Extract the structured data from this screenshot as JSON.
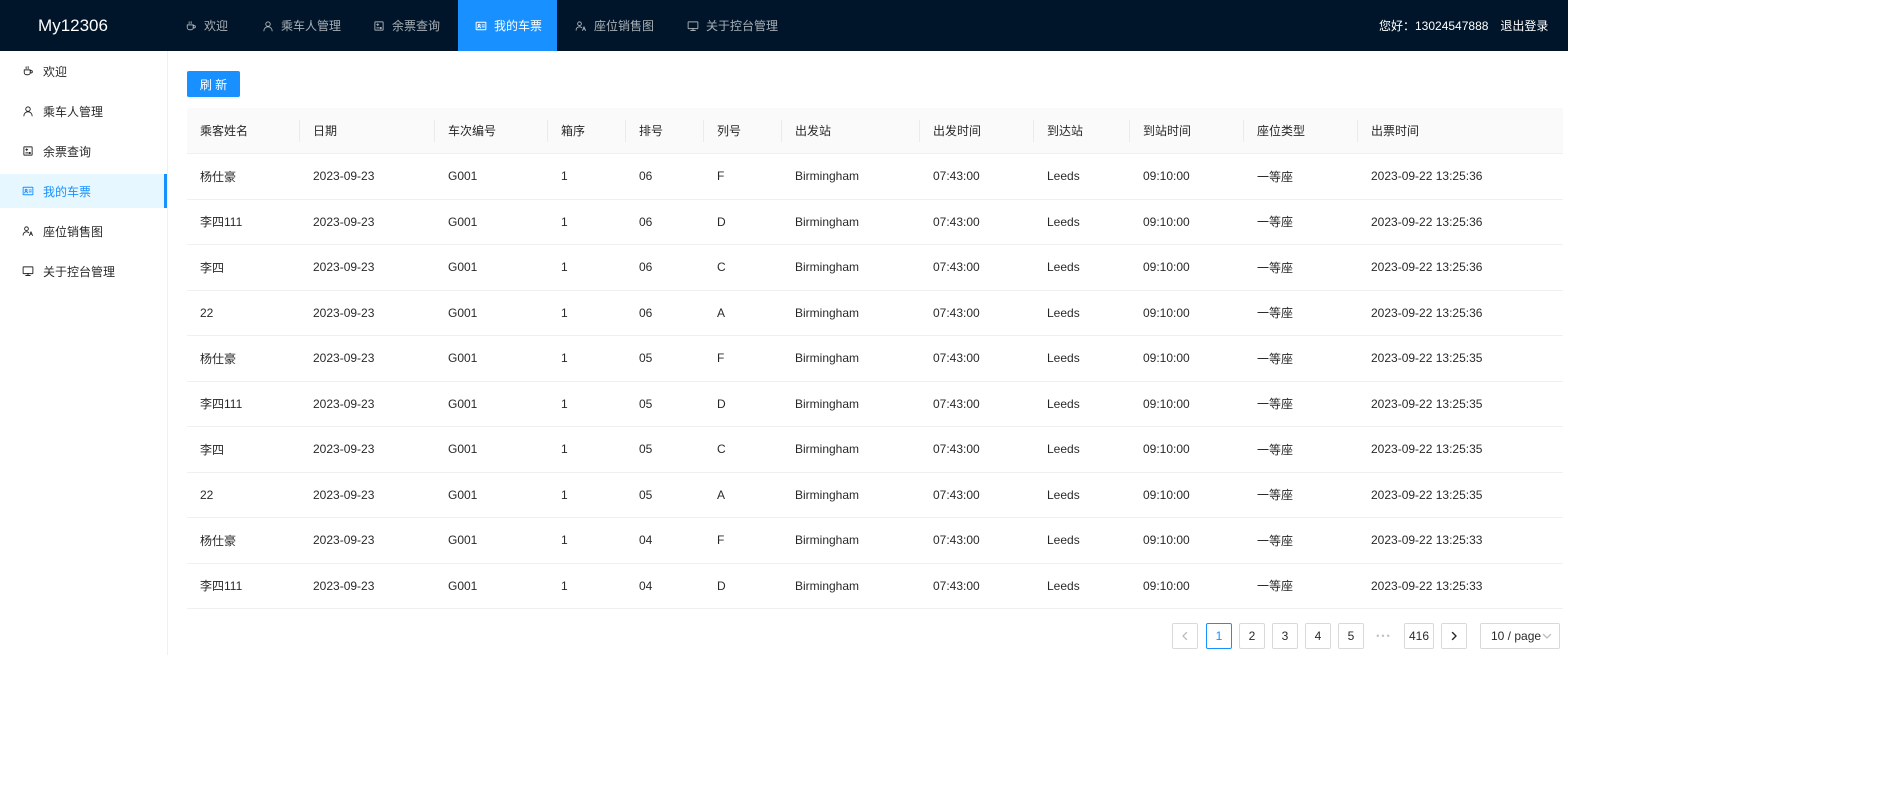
{
  "app": {
    "logo": "My12306"
  },
  "colors": {
    "header_bg": "#001529",
    "accent": "#1890ff",
    "active_bg": "#e6f7ff"
  },
  "topnav": {
    "active_index": 3,
    "items": [
      {
        "label": "欢迎",
        "icon": "coffee-icon"
      },
      {
        "label": "乘车人管理",
        "icon": "user-icon"
      },
      {
        "label": "余票查询",
        "icon": "calculator-icon"
      },
      {
        "label": "我的车票",
        "icon": "idcard-icon"
      },
      {
        "label": "座位销售图",
        "icon": "team-icon"
      },
      {
        "label": "关于控台管理",
        "icon": "desktop-icon"
      }
    ]
  },
  "header_user": {
    "greeting": "您好：13024547888",
    "logout": "退出登录"
  },
  "sidebar": {
    "active_index": 3,
    "items": [
      {
        "label": "欢迎",
        "icon": "coffee-icon"
      },
      {
        "label": "乘车人管理",
        "icon": "user-icon"
      },
      {
        "label": "余票查询",
        "icon": "calculator-icon"
      },
      {
        "label": "我的车票",
        "icon": "idcard-icon"
      },
      {
        "label": "座位销售图",
        "icon": "team-icon"
      },
      {
        "label": "关于控台管理",
        "icon": "desktop-icon"
      }
    ]
  },
  "toolbar": {
    "refresh_label": "刷 新"
  },
  "table": {
    "columns": [
      "乘客姓名",
      "日期",
      "车次编号",
      "箱序",
      "排号",
      "列号",
      "出发站",
      "出发时间",
      "到达站",
      "到站时间",
      "座位类型",
      "出票时间"
    ],
    "rows": [
      [
        "杨仕豪",
        "2023-09-23",
        "G001",
        "1",
        "06",
        "F",
        "Birmingham",
        "07:43:00",
        "Leeds",
        "09:10:00",
        "一等座",
        "2023-09-22 13:25:36"
      ],
      [
        "李四111",
        "2023-09-23",
        "G001",
        "1",
        "06",
        "D",
        "Birmingham",
        "07:43:00",
        "Leeds",
        "09:10:00",
        "一等座",
        "2023-09-22 13:25:36"
      ],
      [
        "李四",
        "2023-09-23",
        "G001",
        "1",
        "06",
        "C",
        "Birmingham",
        "07:43:00",
        "Leeds",
        "09:10:00",
        "一等座",
        "2023-09-22 13:25:36"
      ],
      [
        "22",
        "2023-09-23",
        "G001",
        "1",
        "06",
        "A",
        "Birmingham",
        "07:43:00",
        "Leeds",
        "09:10:00",
        "一等座",
        "2023-09-22 13:25:36"
      ],
      [
        "杨仕豪",
        "2023-09-23",
        "G001",
        "1",
        "05",
        "F",
        "Birmingham",
        "07:43:00",
        "Leeds",
        "09:10:00",
        "一等座",
        "2023-09-22 13:25:35"
      ],
      [
        "李四111",
        "2023-09-23",
        "G001",
        "1",
        "05",
        "D",
        "Birmingham",
        "07:43:00",
        "Leeds",
        "09:10:00",
        "一等座",
        "2023-09-22 13:25:35"
      ],
      [
        "李四",
        "2023-09-23",
        "G001",
        "1",
        "05",
        "C",
        "Birmingham",
        "07:43:00",
        "Leeds",
        "09:10:00",
        "一等座",
        "2023-09-22 13:25:35"
      ],
      [
        "22",
        "2023-09-23",
        "G001",
        "1",
        "05",
        "A",
        "Birmingham",
        "07:43:00",
        "Leeds",
        "09:10:00",
        "一等座",
        "2023-09-22 13:25:35"
      ],
      [
        "杨仕豪",
        "2023-09-23",
        "G001",
        "1",
        "04",
        "F",
        "Birmingham",
        "07:43:00",
        "Leeds",
        "09:10:00",
        "一等座",
        "2023-09-22 13:25:33"
      ],
      [
        "李四111",
        "2023-09-23",
        "G001",
        "1",
        "04",
        "D",
        "Birmingham",
        "07:43:00",
        "Leeds",
        "09:10:00",
        "一等座",
        "2023-09-22 13:25:33"
      ]
    ]
  },
  "pagination": {
    "pages": [
      "1",
      "2",
      "3",
      "4",
      "5"
    ],
    "ellipsis": "•••",
    "last_page": "416",
    "current_index": 0,
    "page_size": "10 / page"
  }
}
